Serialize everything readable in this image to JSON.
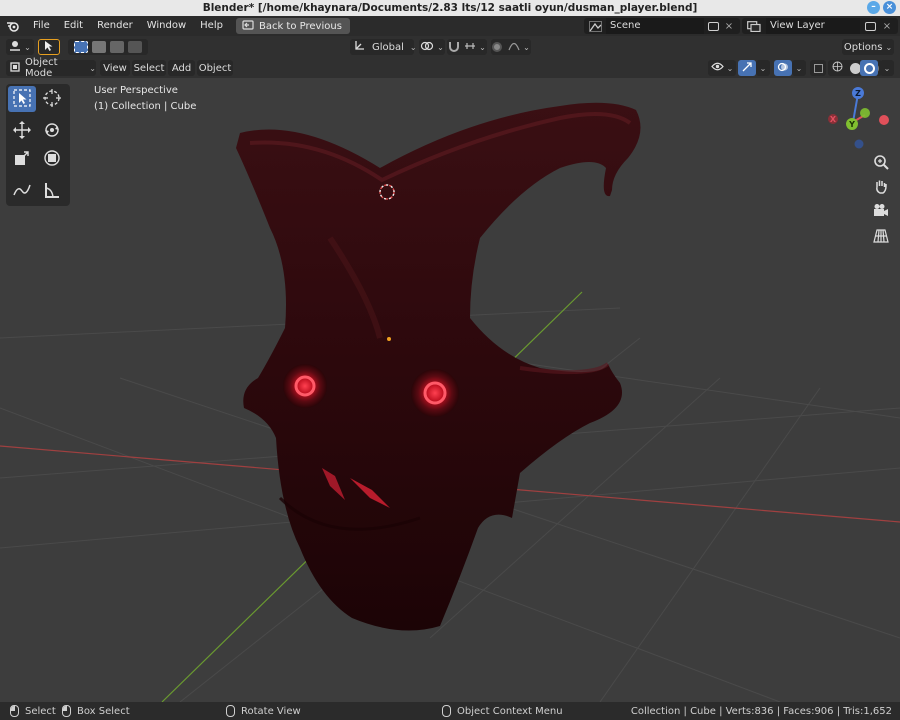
{
  "window": {
    "title": "Blender* [/home/khaynara/Documents/2.83 lts/12 saatli oyun/dusman_player.blend]"
  },
  "menu": {
    "items": [
      "File",
      "Edit",
      "Render",
      "Window",
      "Help"
    ],
    "back_button": "Back to Previous",
    "scene_value": "Scene",
    "view_layer_value": "View Layer"
  },
  "header": {
    "transform_orientation": "Global",
    "options_label": "Options",
    "mode": "Object Mode",
    "view_menu": "View",
    "select_menu": "Select",
    "add_menu": "Add",
    "object_menu": "Object"
  },
  "viewport": {
    "perspective_label": "User Perspective",
    "collection_label": "(1) Collection | Cube",
    "gizmo": {
      "x": "X",
      "y": "Y",
      "z": "Z"
    }
  },
  "status": {
    "select": "Select",
    "box_select": "Box Select",
    "rotate_view": "Rotate View",
    "context_menu": "Object Context Menu",
    "stats": "Collection | Cube | Verts:836 | Faces:906 | Tris:1,652"
  },
  "colors": {
    "accent": "#4772b3",
    "x_axis": "#e0505a",
    "y_axis": "#80c030",
    "z_axis": "#4a7ad8",
    "object": "#3a0e12"
  }
}
